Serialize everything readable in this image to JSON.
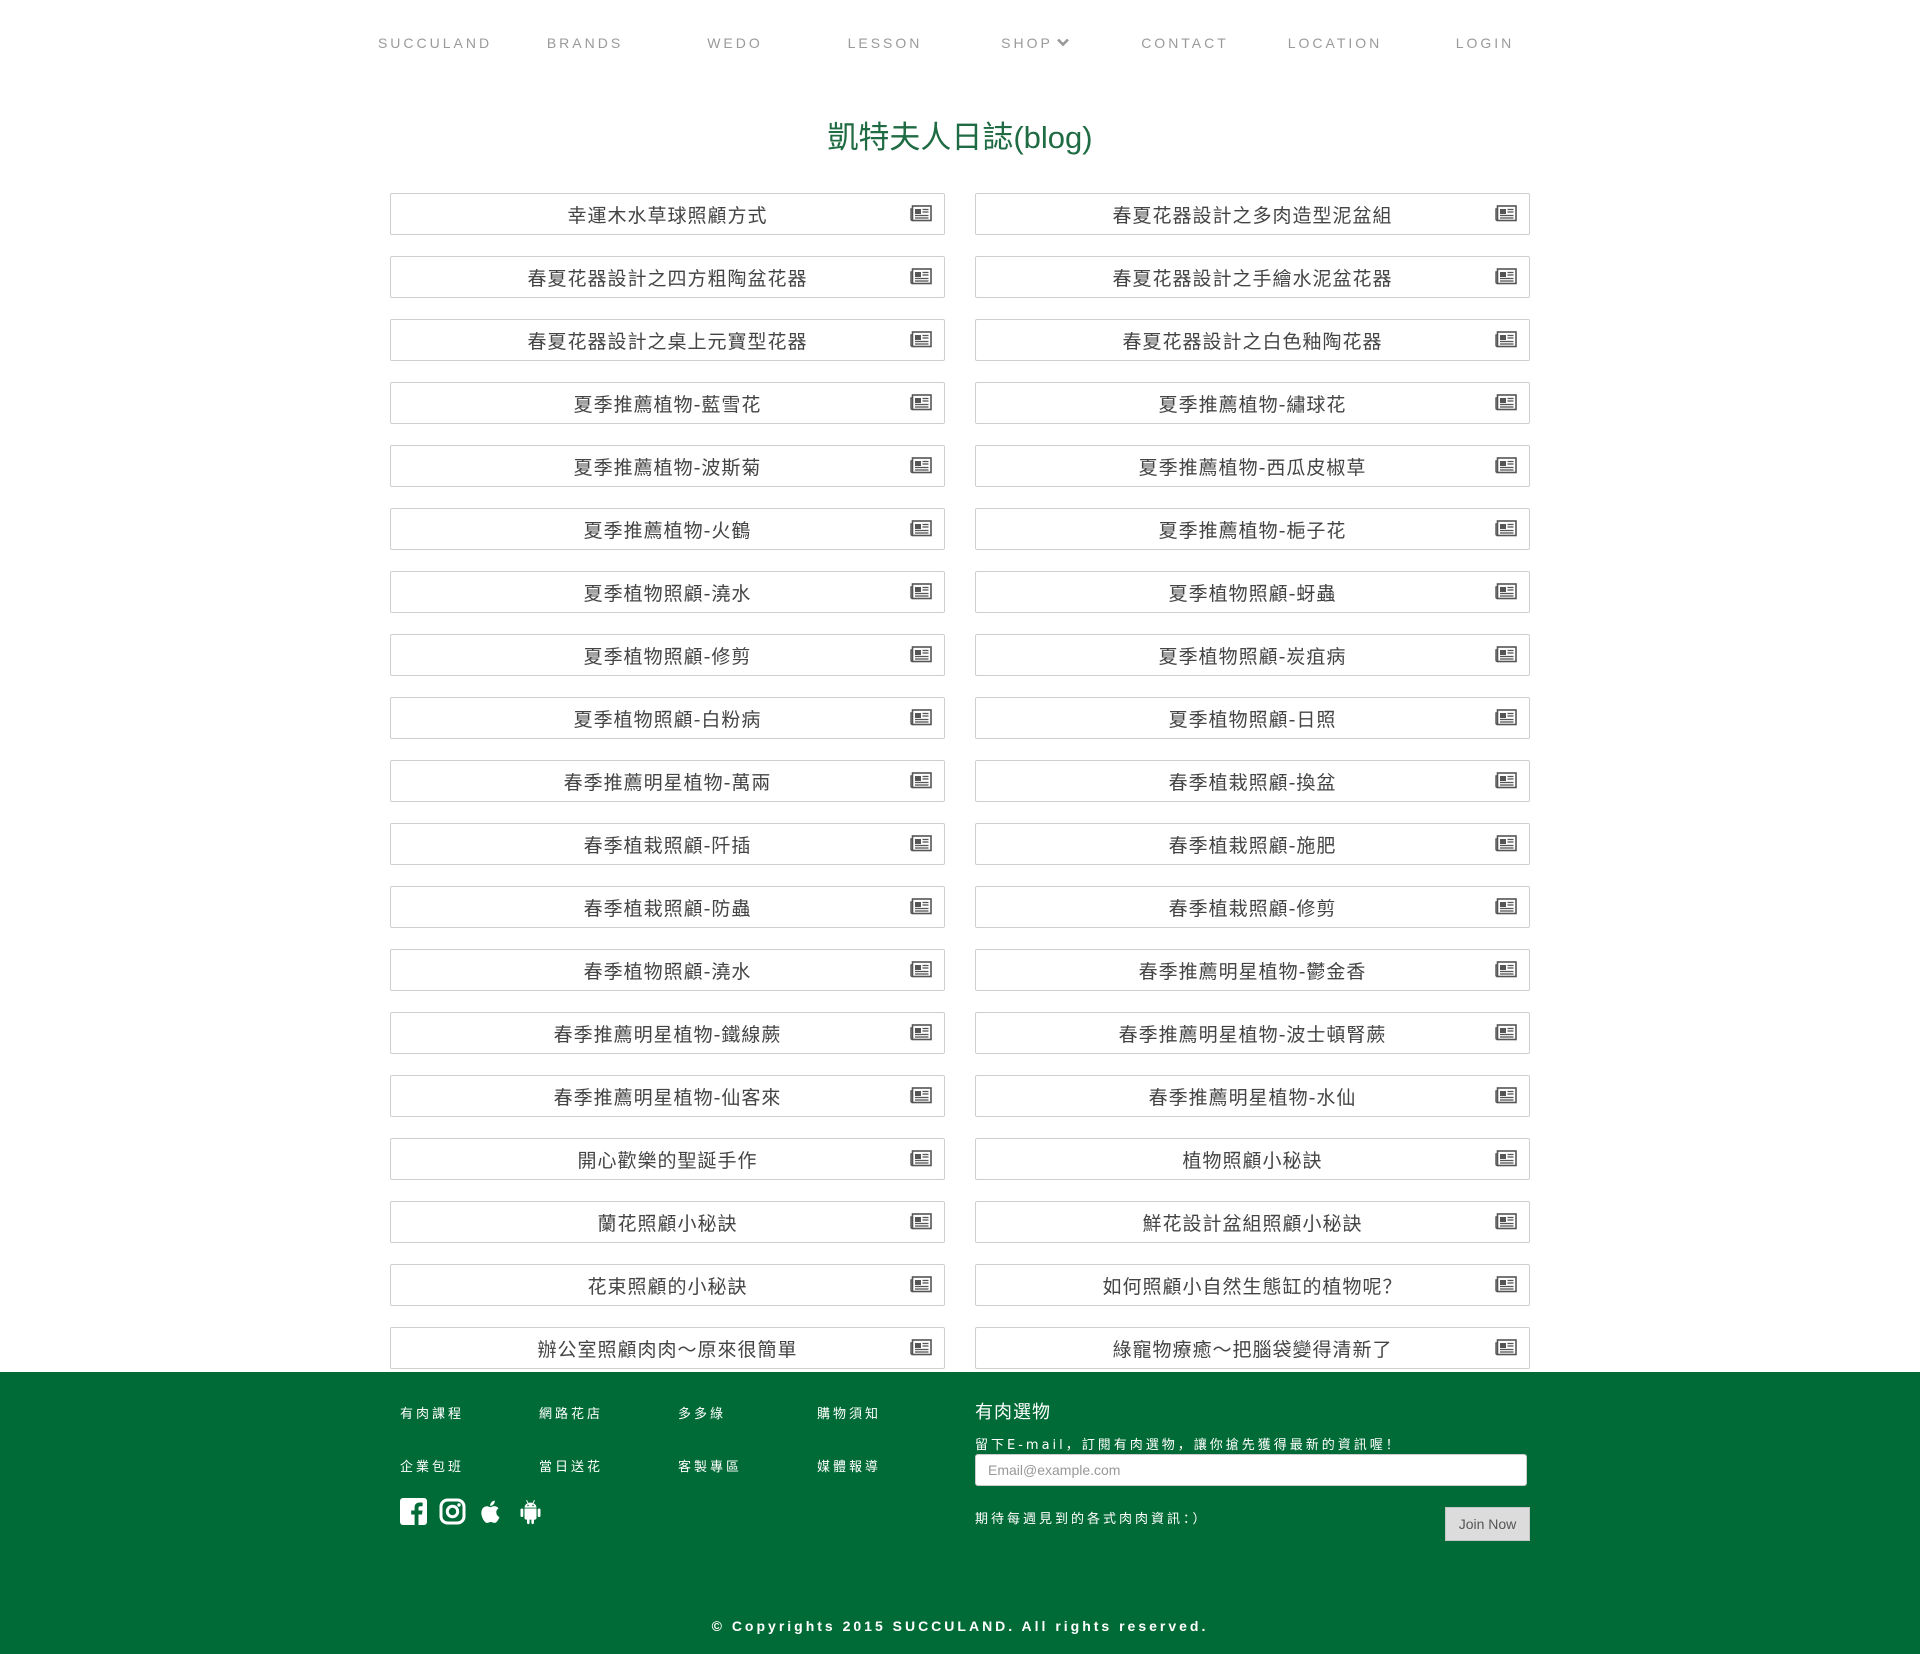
{
  "nav": {
    "items": [
      {
        "label": "SUCCULAND"
      },
      {
        "label": "BRANDS"
      },
      {
        "label": "WEDO"
      },
      {
        "label": "LESSON"
      },
      {
        "label": "SHOP"
      },
      {
        "label": "CONTACT"
      },
      {
        "label": "LOCATION"
      },
      {
        "label": "LOGIN"
      }
    ]
  },
  "page_title": "凱特夫人日誌(blog)",
  "posts": [
    "幸運木水草球照顧方式",
    "春夏花器設計之多肉造型泥盆組",
    "春夏花器設計之四方粗陶盆花器",
    "春夏花器設計之手繪水泥盆花器",
    "春夏花器設計之桌上元寶型花器",
    "春夏花器設計之白色釉陶花器",
    "夏季推薦植物-藍雪花",
    "夏季推薦植物-繡球花",
    "夏季推薦植物-波斯菊",
    "夏季推薦植物-西瓜皮椒草",
    "夏季推薦植物-火鶴",
    "夏季推薦植物-梔子花",
    "夏季植物照顧-澆水",
    "夏季植物照顧-蚜蟲",
    "夏季植物照顧-修剪",
    "夏季植物照顧-炭疽病",
    "夏季植物照顧-白粉病",
    "夏季植物照顧-日照",
    "春季推薦明星植物-萬兩",
    "春季植栽照顧-換盆",
    "春季植栽照顧-阡插",
    "春季植栽照顧-施肥",
    "春季植栽照顧-防蟲",
    "春季植栽照顧-修剪",
    "春季植物照顧-澆水",
    "春季推薦明星植物-鬱金香",
    "春季推薦明星植物-鐵線蕨",
    "春季推薦明星植物-波士頓腎蕨",
    "春季推薦明星植物-仙客來",
    "春季推薦明星植物-水仙",
    "開心歡樂的聖誕手作",
    "植物照顧小秘訣",
    "蘭花照顧小秘訣",
    "鮮花設計盆組照顧小秘訣",
    "花束照顧的小秘訣",
    "如何照顧小自然生態缸的植物呢？",
    "辦公室照顧肉肉～原來很簡單",
    "綠寵物療癒～把腦袋變得清新了"
  ],
  "footer": {
    "links": [
      "有肉課程",
      "網路花店",
      "多多綠",
      "購物須知",
      "企業包班",
      "當日送花",
      "客製專區",
      "媒體報導"
    ],
    "social_icons": [
      "facebook-icon",
      "instagram-icon",
      "apple-icon",
      "android-icon"
    ],
    "newsletter": {
      "heading": "有肉選物",
      "subtitle": "留下E-mail，訂閱有肉選物，讓你搶先獲得最新的資訊喔！",
      "email_placeholder": "Email@example.com",
      "note": "期待每週見到的各式肉肉資訊：）",
      "join_label": "Join Now"
    },
    "copyright": "© Copyrights 2015 SUCCULAND. All rights reserved."
  },
  "colors": {
    "brand_green": "#006b36",
    "title_green": "#1f6b43"
  }
}
